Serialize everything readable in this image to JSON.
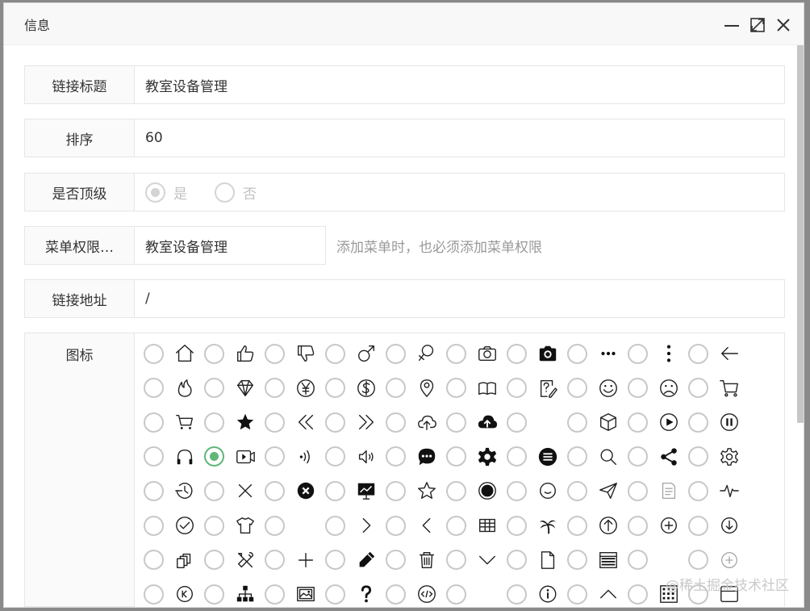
{
  "dialog": {
    "title": "信息"
  },
  "form": {
    "link_title": {
      "label": "链接标题",
      "value": "教室设备管理"
    },
    "sort": {
      "label": "排序",
      "value": "60"
    },
    "top_level": {
      "label": "是否顶级",
      "options": [
        "是",
        "否"
      ],
      "selected": "是",
      "disabled": true
    },
    "menu_perm": {
      "label": "菜单权限…",
      "value": "教室设备管理",
      "hint": "添加菜单时，也必须添加菜单权限"
    },
    "link_url": {
      "label": "链接地址",
      "value": "/"
    },
    "icon": {
      "label": "图标",
      "selected_index": 31,
      "rows": [
        [
          "home-icon",
          "thumbs-up-icon",
          "thumbs-down-icon",
          "male-icon",
          "female-icon",
          "camera-outline-icon",
          "camera-filled-icon",
          "more-horizontal-icon",
          "more-vertical-icon",
          "arrow-left-icon"
        ],
        [
          "fire-icon",
          "diamond-icon",
          "yen-icon",
          "dollar-icon",
          "location-pin-icon",
          "book-open-icon",
          "form-edit-icon",
          "smile-icon",
          "frown-icon",
          "cart-outline-icon"
        ],
        [
          "cart-simple-icon",
          "star-filled-icon",
          "double-left-icon",
          "double-right-icon",
          "cloud-upload-icon",
          "cloud-upload-filled-icon",
          "blank",
          "cube-icon",
          "play-circle-icon",
          "pause-circle-icon"
        ],
        [
          "headset-icon",
          "video-icon",
          "sound-waves-icon",
          "volume-icon",
          "chat-bubble-icon",
          "gear-filled-icon",
          "menu-circle-icon",
          "search-icon",
          "share-icon",
          "gear-outline-icon"
        ],
        [
          "timer-icon",
          "close-thin-icon",
          "close-circle-filled-icon",
          "presentation-icon",
          "star-outline-icon",
          "record-icon",
          "face-icon",
          "send-icon",
          "notes-icon",
          "pulse-icon"
        ],
        [
          "check-circle-icon",
          "shirt-icon",
          "blank",
          "chevron-right-icon",
          "chevron-left-icon",
          "table-icon",
          "palm-tree-icon",
          "up-circle-icon",
          "add-circle-icon",
          "down-circle-icon"
        ],
        [
          "layers-icon",
          "tools-icon",
          "plus-icon",
          "pencil-icon",
          "trash-icon",
          "chevron-down-icon",
          "file-icon",
          "browser-window-icon",
          "blank",
          "add-circle-light-icon"
        ],
        [
          "back-circle-icon",
          "network-icon",
          "picture-icon",
          "help-icon",
          "code-circle-icon",
          "blank",
          "info-circle-icon",
          "chevron-up-icon",
          "grid-icon",
          "window-icon"
        ]
      ]
    }
  },
  "watermark": "@稀土掘金技术社区"
}
